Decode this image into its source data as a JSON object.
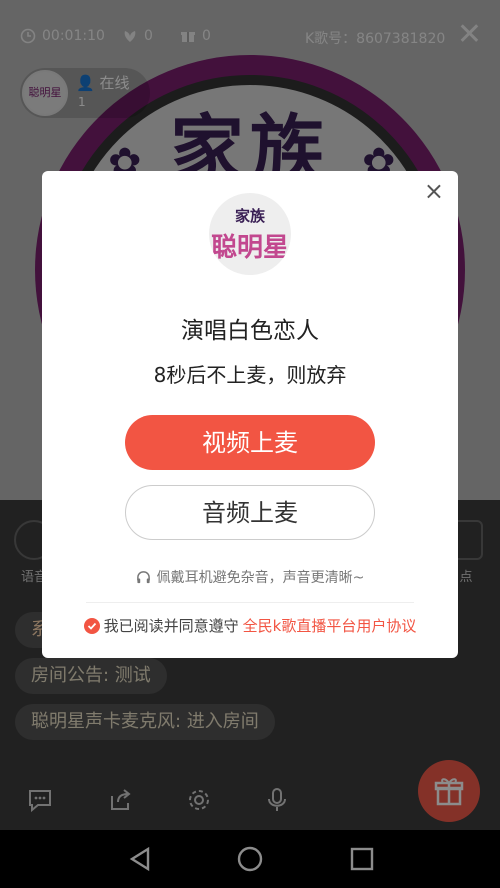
{
  "topbar": {
    "timer": "00:01:10",
    "likes": "0",
    "gifts": "0",
    "room_id": "K歌号：8607381820"
  },
  "online": {
    "label": "在线",
    "count": "1",
    "avatar_text": "聪明星"
  },
  "background": {
    "emblem_title": "家族"
  },
  "side_buttons": {
    "left_label": "语音",
    "right_label": "点"
  },
  "chat": [
    {
      "text": "系"
    },
    {
      "text": "房间公告: 测试"
    },
    {
      "text": "聪明星声卡麦克风: 进入房间"
    }
  ],
  "dialog": {
    "avatar_top": "家族",
    "avatar_bottom": "聪明星",
    "song_title": "演唱白色恋人",
    "countdown": "8秒后不上麦，则放弃",
    "video_button": "视频上麦",
    "audio_button": "音频上麦",
    "tip": "佩戴耳机避免杂音，声音更清晰~",
    "agree_prefix": "我已阅读并同意遵守",
    "agree_link": "全民k歌直播平台用户协议",
    "close_symbol": "×"
  },
  "colors": {
    "accent": "#f25543",
    "emblem_purple": "#7a1f6e"
  }
}
